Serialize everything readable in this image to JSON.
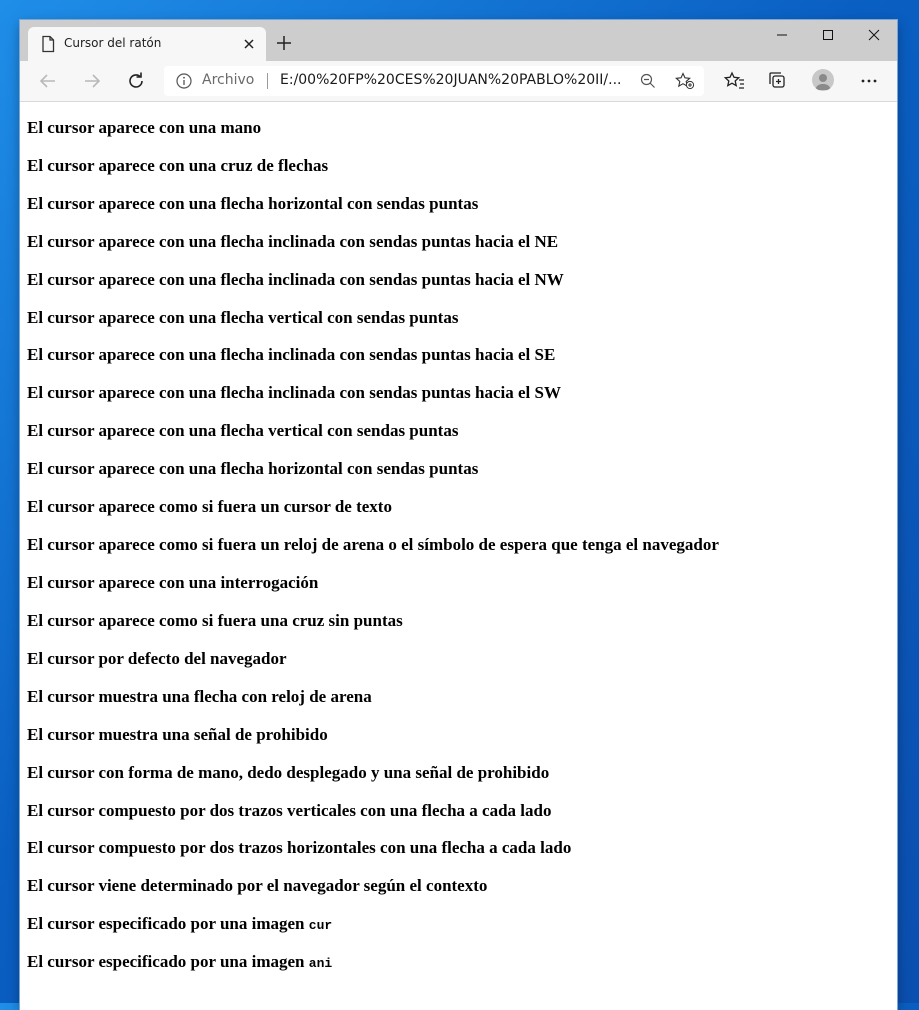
{
  "browser": {
    "tab_title": "Cursor del ratón",
    "address_protocol": "Archivo",
    "address_url": "E:/00%20FP%20CES%20JUAN%20PABLO%20II/...",
    "accent_color": "#0a5fc2"
  },
  "content": {
    "lines": [
      {
        "text": "El cursor aparece con una mano"
      },
      {
        "text": "El cursor aparece con una cruz de flechas"
      },
      {
        "text": "El cursor aparece con una flecha horizontal con sendas puntas"
      },
      {
        "text": "El cursor aparece con una flecha inclinada con sendas puntas hacia el NE"
      },
      {
        "text": "El cursor aparece con una flecha inclinada con sendas puntas hacia el NW"
      },
      {
        "text": "El cursor aparece con una flecha vertical con sendas puntas"
      },
      {
        "text": "El cursor aparece con una flecha inclinada con sendas puntas hacia el SE"
      },
      {
        "text": "El cursor aparece con una flecha inclinada con sendas puntas hacia el SW"
      },
      {
        "text": "El cursor aparece con una flecha vertical con sendas puntas"
      },
      {
        "text": "El cursor aparece con una flecha horizontal con sendas puntas"
      },
      {
        "text": "El cursor aparece como si fuera un cursor de texto"
      },
      {
        "text": "El cursor aparece como si fuera un reloj de arena o el símbolo de espera que tenga el navegador"
      },
      {
        "text": "El cursor aparece con una interrogación"
      },
      {
        "text": "El cursor aparece como si fuera una cruz sin puntas"
      },
      {
        "text": "El cursor por defecto del navegador"
      },
      {
        "text": "El cursor muestra una flecha con reloj de arena"
      },
      {
        "text": "El cursor muestra una señal de prohibido"
      },
      {
        "text": "El cursor con forma de mano, dedo desplegado y una señal de prohibido"
      },
      {
        "text": "El cursor compuesto por dos trazos verticales con una flecha a cada lado"
      },
      {
        "text": "El cursor compuesto por dos trazos horizontales con una flecha a cada lado"
      },
      {
        "text": "El cursor viene determinado por el navegador según el contexto"
      },
      {
        "text": "El cursor especificado por una imagen ",
        "code": "cur"
      },
      {
        "text": "El cursor especificado por una imagen ",
        "code": "ani"
      }
    ]
  }
}
